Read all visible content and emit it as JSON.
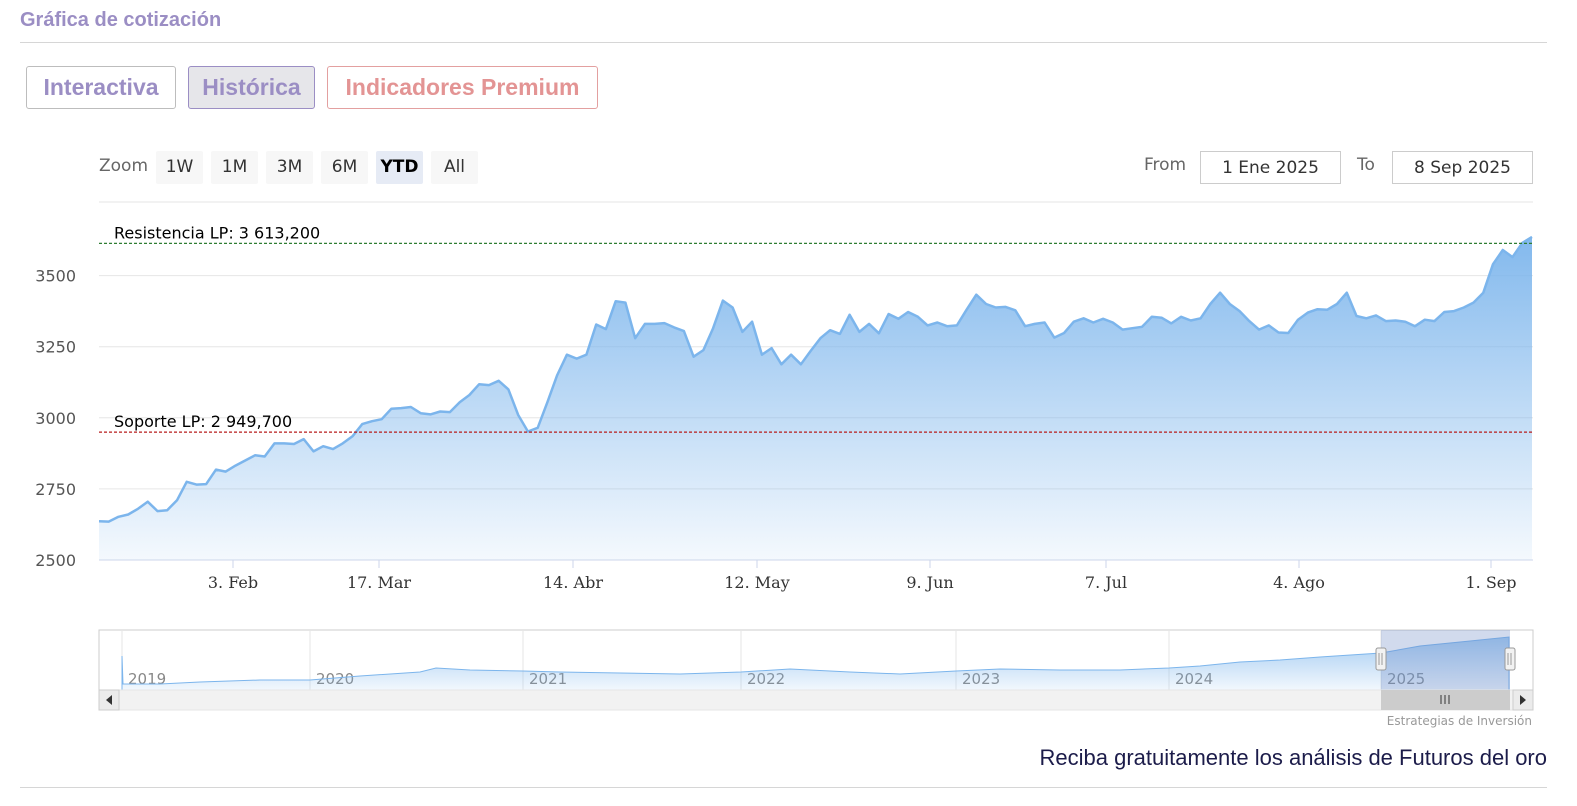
{
  "header": {
    "title": "Gráfica de cotización"
  },
  "tabs": [
    {
      "label": "Interactiva"
    },
    {
      "label": "Histórica"
    },
    {
      "label": "Indicadores Premium"
    }
  ],
  "zoom": {
    "label": "Zoom",
    "buttons": [
      "1W",
      "1M",
      "3M",
      "6M",
      "YTD",
      "All"
    ],
    "selected": "YTD"
  },
  "range": {
    "from_label": "From",
    "from_value": "1 Ene 2025",
    "to_label": "To",
    "to_value": "8 Sep 2025"
  },
  "chart_data": {
    "type": "area",
    "y_ticks": [
      2500,
      2750,
      3000,
      3250,
      3500
    ],
    "ylim": [
      2500,
      3750
    ],
    "x_ticks": [
      "3. Feb",
      "17. Mar",
      "14. Abr",
      "12. May",
      "9. Jun",
      "7. Jul",
      "4. Ago",
      "1. Sep"
    ],
    "plot_lines": [
      {
        "label": "Resistencia LP: 3 613,200",
        "value": 3613.2,
        "color": "#2e7d32"
      },
      {
        "label": "Soporte LP: 2 949,700",
        "value": 2949.7,
        "color": "#b71c1c"
      }
    ],
    "series": [
      {
        "values": [
          2636,
          2635,
          2652,
          2660,
          2680,
          2705,
          2672,
          2675,
          2710,
          2775,
          2765,
          2767,
          2818,
          2811,
          2832,
          2850,
          2868,
          2864,
          2910,
          2910,
          2908,
          2925,
          2882,
          2900,
          2890,
          2910,
          2935,
          2978,
          2988,
          2995,
          3032,
          3034,
          3038,
          3016,
          3012,
          3022,
          3020,
          3055,
          3080,
          3118,
          3115,
          3130,
          3100,
          3010,
          2952,
          2965,
          3055,
          3150,
          3222,
          3208,
          3222,
          3328,
          3312,
          3410,
          3405,
          3280,
          3330,
          3330,
          3333,
          3318,
          3305,
          3215,
          3238,
          3315,
          3412,
          3388,
          3302,
          3338,
          3222,
          3245,
          3188,
          3222,
          3188,
          3235,
          3280,
          3308,
          3295,
          3362,
          3302,
          3330,
          3297,
          3365,
          3348,
          3372,
          3355,
          3325,
          3335,
          3322,
          3325,
          3380,
          3433,
          3400,
          3388,
          3390,
          3378,
          3322,
          3330,
          3335,
          3282,
          3298,
          3338,
          3350,
          3335,
          3348,
          3335,
          3310,
          3315,
          3320,
          3355,
          3352,
          3332,
          3355,
          3342,
          3350,
          3400,
          3440,
          3400,
          3375,
          3340,
          3310,
          3325,
          3300,
          3298,
          3345,
          3370,
          3382,
          3380,
          3400,
          3440,
          3358,
          3350,
          3360,
          3340,
          3342,
          3338,
          3322,
          3345,
          3340,
          3372,
          3375,
          3388,
          3405,
          3440,
          3540,
          3590,
          3565,
          3615,
          3636
        ]
      }
    ],
    "navigator": {
      "years": [
        "2019",
        "2020",
        "2021",
        "2022",
        "2023",
        "2024",
        "2025"
      ]
    },
    "credit": "Estrategias de Inversión"
  },
  "footer": {
    "cta": "Reciba gratuitamente los análisis de Futuros del oro"
  }
}
